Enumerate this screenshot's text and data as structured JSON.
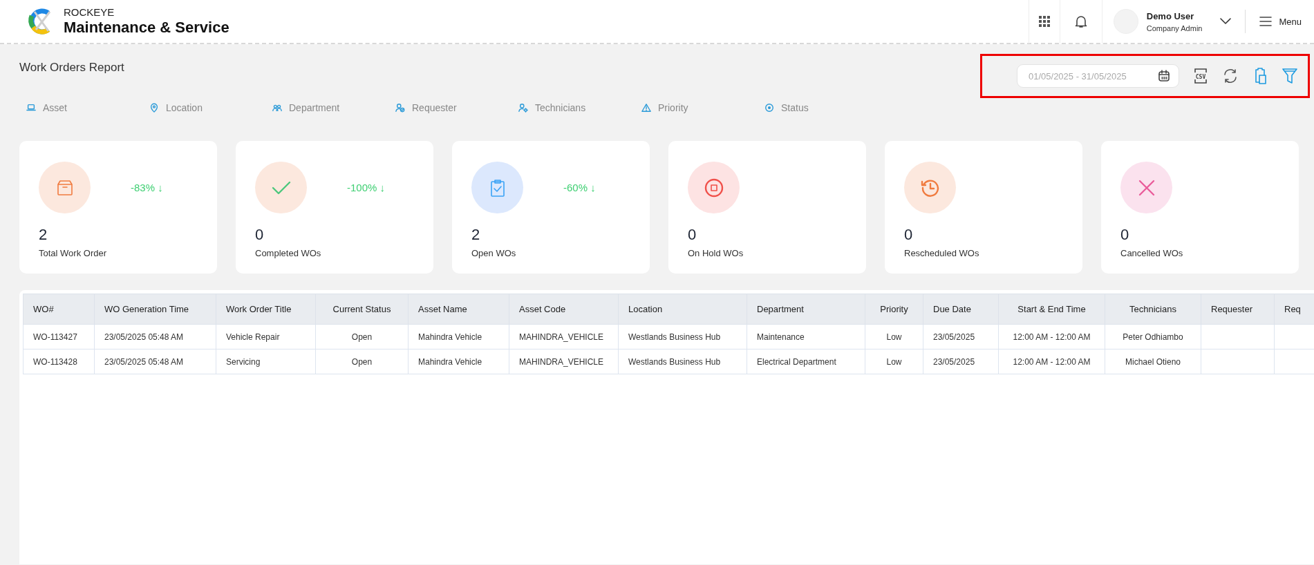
{
  "header": {
    "brand": "ROCKEYE",
    "product": "Maintenance & Service",
    "user": {
      "name": "Demo User",
      "role": "Company Admin"
    },
    "menu_label": "Menu"
  },
  "page_title": "Work Orders Report",
  "toolbar": {
    "date_range": {
      "placeholder": "01/05/2025 - 31/05/2025"
    },
    "buttons": [
      {
        "kind": "csv",
        "label": "CSV"
      },
      {
        "kind": "refresh"
      },
      {
        "kind": "clipboard"
      },
      {
        "kind": "filter"
      }
    ]
  },
  "filters": [
    {
      "kind": "asset",
      "label": "Asset"
    },
    {
      "kind": "location",
      "label": "Location"
    },
    {
      "kind": "department",
      "label": "Department"
    },
    {
      "kind": "requester",
      "label": "Requester"
    },
    {
      "kind": "technicians",
      "label": "Technicians"
    },
    {
      "kind": "priority",
      "label": "Priority"
    },
    {
      "kind": "status",
      "label": "Status"
    }
  ],
  "cards": [
    {
      "kind": "total",
      "value": "2",
      "label": "Total Work Order",
      "change": "-83% ↓"
    },
    {
      "kind": "completed",
      "value": "0",
      "label": "Completed WOs",
      "change": "-100% ↓"
    },
    {
      "kind": "open",
      "value": "2",
      "label": "Open WOs",
      "change": "-60% ↓"
    },
    {
      "kind": "hold",
      "value": "0",
      "label": "On Hold WOs"
    },
    {
      "kind": "rescheduled",
      "value": "0",
      "label": "Rescheduled WOs"
    },
    {
      "kind": "cancelled",
      "value": "0",
      "label": "Cancelled WOs"
    }
  ],
  "table": {
    "columns": [
      "WO#",
      "WO Generation Time",
      "Work Order Title",
      "Current Status",
      "Asset Name",
      "Asset Code",
      "Location",
      "Department",
      "Priority",
      "Due Date",
      "Start & End Time",
      "Technicians",
      "Requester",
      "Req"
    ],
    "rows": [
      [
        "WO-113427",
        "23/05/2025 05:48 AM",
        "Vehicle Repair",
        "Open",
        "Mahindra Vehicle",
        "MAHINDRA_VEHICLE",
        "Westlands Business Hub",
        "Maintenance",
        "Low",
        "23/05/2025",
        "12:00 AM - 12:00 AM",
        "Peter Odhiambo",
        "",
        ""
      ],
      [
        "WO-113428",
        "23/05/2025 05:48 AM",
        "Servicing",
        "Open",
        "Mahindra Vehicle",
        "MAHINDRA_VEHICLE",
        "Westlands Business Hub",
        "Electrical Department",
        "Low",
        "23/05/2025",
        "12:00 AM - 12:00 AM",
        "Michael Otieno",
        "",
        ""
      ]
    ]
  }
}
